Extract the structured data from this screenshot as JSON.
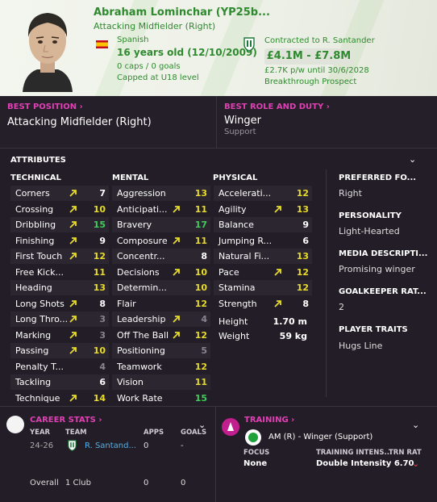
{
  "player": {
    "name": "Abraham Lominchar (YP25b...",
    "position": "Attacking Midfielder (Right)",
    "nationality": "Spanish",
    "age": "16 years old (12/10/2009)",
    "caps": "0 caps / 0 goals",
    "capped": "Capped at U18 level",
    "contract": "Contracted to R. Santander",
    "value": "£4.1M - £7.8M",
    "wage": "£2.7K p/w until 30/6/2028",
    "status": "Breakthrough Prospect"
  },
  "best_position": {
    "label": "BEST POSITION",
    "value": "Attacking Midfielder (Right)"
  },
  "best_role": {
    "label": "BEST ROLE AND DUTY",
    "role": "Winger",
    "duty": "Support"
  },
  "attributes": {
    "title": "ATTRIBUTES",
    "technical": {
      "title": "TECHNICAL",
      "items": [
        {
          "name": "Corners",
          "value": "7",
          "arrow": true
        },
        {
          "name": "Crossing",
          "value": "10",
          "arrow": true
        },
        {
          "name": "Dribbling",
          "value": "15",
          "arrow": true
        },
        {
          "name": "Finishing",
          "value": "9",
          "arrow": true
        },
        {
          "name": "First Touch",
          "value": "12",
          "arrow": true
        },
        {
          "name": "Free Kick...",
          "value": "11",
          "arrow": false
        },
        {
          "name": "Heading",
          "value": "13",
          "arrow": false
        },
        {
          "name": "Long Shots",
          "value": "8",
          "arrow": true
        },
        {
          "name": "Long Thro...",
          "value": "3",
          "arrow": true
        },
        {
          "name": "Marking",
          "value": "3",
          "arrow": true
        },
        {
          "name": "Passing",
          "value": "10",
          "arrow": true
        },
        {
          "name": "Penalty T...",
          "value": "4",
          "arrow": false
        },
        {
          "name": "Tackling",
          "value": "6",
          "arrow": false
        },
        {
          "name": "Technique",
          "value": "14",
          "arrow": true
        }
      ]
    },
    "mental": {
      "title": "MENTAL",
      "items": [
        {
          "name": "Aggression",
          "value": "13",
          "arrow": false
        },
        {
          "name": "Anticipati...",
          "value": "11",
          "arrow": true
        },
        {
          "name": "Bravery",
          "value": "17",
          "arrow": false
        },
        {
          "name": "Composure",
          "value": "11",
          "arrow": true
        },
        {
          "name": "Concentr...",
          "value": "8",
          "arrow": false
        },
        {
          "name": "Decisions",
          "value": "10",
          "arrow": true
        },
        {
          "name": "Determin...",
          "value": "10",
          "arrow": false
        },
        {
          "name": "Flair",
          "value": "12",
          "arrow": false
        },
        {
          "name": "Leadership",
          "value": "4",
          "arrow": true
        },
        {
          "name": "Off The Ball",
          "value": "12",
          "arrow": true
        },
        {
          "name": "Positioning",
          "value": "5",
          "arrow": false
        },
        {
          "name": "Teamwork",
          "value": "12",
          "arrow": false
        },
        {
          "name": "Vision",
          "value": "11",
          "arrow": false
        },
        {
          "name": "Work Rate",
          "value": "15",
          "arrow": false
        }
      ]
    },
    "physical": {
      "title": "PHYSICAL",
      "items": [
        {
          "name": "Accelerati...",
          "value": "12",
          "arrow": false
        },
        {
          "name": "Agility",
          "value": "13",
          "arrow": true
        },
        {
          "name": "Balance",
          "value": "9",
          "arrow": false
        },
        {
          "name": "Jumping R...",
          "value": "6",
          "arrow": false
        },
        {
          "name": "Natural Fi...",
          "value": "13",
          "arrow": false
        },
        {
          "name": "Pace",
          "value": "12",
          "arrow": true
        },
        {
          "name": "Stamina",
          "value": "12",
          "arrow": false
        },
        {
          "name": "Strength",
          "value": "8",
          "arrow": true
        }
      ],
      "height_label": "Height",
      "height": "1.70 m",
      "weight_label": "Weight",
      "weight": "59 kg"
    }
  },
  "side_info": [
    {
      "title": "PREFERRED FO...",
      "value": "Right"
    },
    {
      "title": "PERSONALITY",
      "value": "Light-Hearted"
    },
    {
      "title": "MEDIA DESCRIPTI...",
      "value": "Promising winger"
    },
    {
      "title": "GOALKEEPER RAT...",
      "value": "2"
    },
    {
      "title": "PLAYER TRAITS",
      "value": "Hugs Line"
    }
  ],
  "career": {
    "title": "CAREER STATS",
    "headers": {
      "year": "YEAR",
      "team": "TEAM",
      "apps": "APPS",
      "goals": "GOALS"
    },
    "rows": [
      {
        "year": "24-26",
        "team": "R. Santand...",
        "apps": "0",
        "goals": "-"
      }
    ],
    "total": {
      "label": "Overall",
      "team": "1 Club",
      "apps": "0",
      "goals": "0"
    }
  },
  "training": {
    "title": "TRAINING",
    "role": "AM (R) - Winger (Support)",
    "focus_label": "FOCUS",
    "focus": "None",
    "intensity_label": "TRAINING INTENS...",
    "rating_label": "TRN RAT",
    "intensity": "Double Intensity",
    "rating": "6.70"
  },
  "colors": {
    "accent_pink": "#e040b4",
    "value_high": "#3ecf5a",
    "value_mid": "#e8dc2a",
    "value_low": "#ffffff",
    "value_vlow": "#8a8590",
    "header_green": "#2f8a2f"
  }
}
